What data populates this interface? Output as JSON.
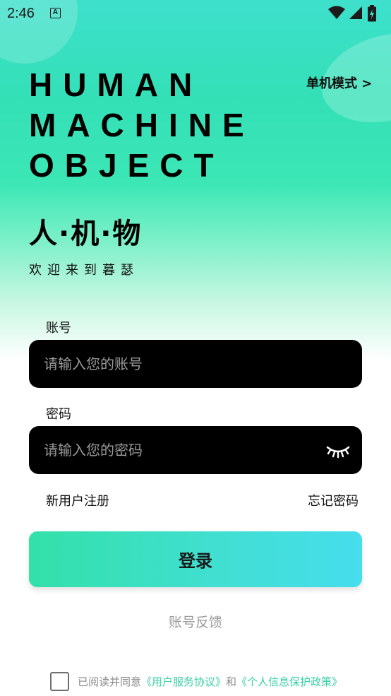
{
  "status_bar": {
    "time": "2:46",
    "app_icon_letter": "A",
    "icons": [
      "wifi-icon",
      "signal-icon",
      "battery-charging-icon"
    ]
  },
  "header": {
    "title_lines": [
      "HUMAN",
      "MACHINE",
      "OBJECT"
    ],
    "mode_link": "单机模式 >",
    "brand_cn": "人·机·物",
    "welcome": "欢迎来到暮瑟"
  },
  "form": {
    "account_label": "账号",
    "account_placeholder": "请输入您的账号",
    "password_label": "密码",
    "password_placeholder": "请输入您的密码",
    "password_toggle_icon": "eye-closed-icon",
    "register_link": "新用户注册",
    "forgot_link": "忘记密码",
    "login_button": "登录"
  },
  "feedback_link": "账号反馈",
  "agreement": {
    "prefix": "已阅读并同意",
    "user_agreement": "《用户服务协议》",
    "connector": "和",
    "privacy_policy": "《个人信息保护政策》",
    "checked": false
  },
  "colors": {
    "gradient_top": "#3ee0cc",
    "gradient_mid": "#3ce7b5",
    "input_bg": "#000000",
    "button_start": "#33e0a8",
    "button_end": "#46dded",
    "policy_link": "#38cfa6"
  }
}
